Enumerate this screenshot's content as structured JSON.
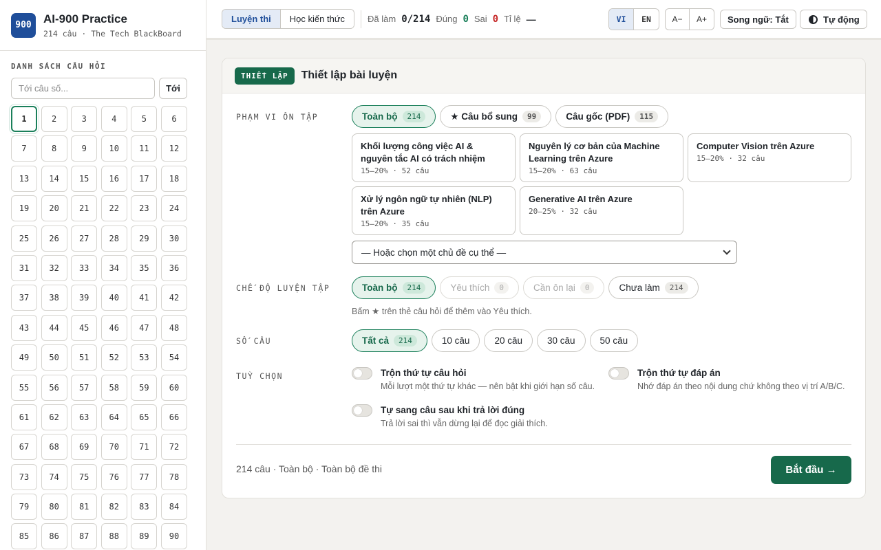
{
  "brand": {
    "logo": "900",
    "title": "AI-900 Practice",
    "subtitle": "214 câu · The Tech BlackBoard"
  },
  "sidebar": {
    "section_label": "DANH SÁCH CÂU HỎI",
    "goto_placeholder": "Tới câu số...",
    "goto_button": "Tới",
    "active_question": 1,
    "visible_questions": [
      "1",
      "2",
      "3",
      "4",
      "5",
      "6",
      "7",
      "8",
      "9",
      "10",
      "11",
      "12",
      "13",
      "14",
      "15",
      "16",
      "17",
      "18",
      "19",
      "20",
      "21",
      "22",
      "23",
      "24",
      "25",
      "26",
      "27",
      "28",
      "29",
      "30",
      "31",
      "32",
      "33",
      "34",
      "35",
      "36",
      "37",
      "38",
      "39",
      "40",
      "41",
      "42",
      "43",
      "44",
      "45",
      "46",
      "47",
      "48",
      "49",
      "50",
      "51",
      "52",
      "53",
      "54",
      "55",
      "56",
      "57",
      "58",
      "59",
      "60",
      "61",
      "62",
      "63",
      "64",
      "65",
      "66",
      "67",
      "68",
      "69",
      "70",
      "71",
      "72",
      "73",
      "74",
      "75",
      "76",
      "77",
      "78",
      "79",
      "80",
      "81",
      "82",
      "83",
      "84",
      "85",
      "86",
      "87",
      "88",
      "89",
      "90"
    ]
  },
  "topbar": {
    "tabs": [
      "Luyện thi",
      "Học kiến thức"
    ],
    "active_tab": "Luyện thi",
    "done_label": "Đã làm",
    "done_value": "0/214",
    "correct_label": "Đúng",
    "correct_value": "0",
    "wrong_label": "Sai",
    "wrong_value": "0",
    "ratio_label": "Tỉ lệ",
    "ratio_value": "—",
    "languages": [
      "VI",
      "EN"
    ],
    "active_language": "VI",
    "font_smaller": "A−",
    "font_larger": "A+",
    "bilingual_button": "Song ngữ: Tắt",
    "theme_button": "Tự động"
  },
  "card": {
    "tag": "THIẾT LẬP",
    "title": "Thiết lập bài luyện",
    "scope": {
      "label": "PHẠM VI ÔN TẬP",
      "chips": [
        {
          "label": "Toàn bộ",
          "count": "214",
          "active": true
        },
        {
          "label": "★ Câu bổ sung",
          "count": "99",
          "active": false
        },
        {
          "label": "Câu gốc (PDF)",
          "count": "115",
          "active": false
        }
      ],
      "domains": [
        {
          "title": "Khối lượng công việc AI & nguyên tắc AI có trách nhiệm",
          "meta": "15–20% · 52 câu"
        },
        {
          "title": "Nguyên lý cơ bản của Machine Learning trên Azure",
          "meta": "15–20% · 63 câu"
        },
        {
          "title": "Computer Vision trên Azure",
          "meta": "15–20% · 32 câu"
        },
        {
          "title": "Xử lý ngôn ngữ tự nhiên (NLP) trên Azure",
          "meta": "15–20% · 35 câu"
        },
        {
          "title": "Generative AI trên Azure",
          "meta": "20–25% · 32 câu"
        }
      ],
      "topic_select": "— Hoặc chọn một chủ đề cụ thể —"
    },
    "mode": {
      "label": "CHẾ ĐỘ LUYỆN TẬP",
      "chips": [
        {
          "label": "Toàn bộ",
          "count": "214"
        },
        {
          "label": "Yêu thích",
          "count": "0"
        },
        {
          "label": "Cần ôn lại",
          "count": "0"
        },
        {
          "label": "Chưa làm",
          "count": "214"
        }
      ],
      "hint": "Bấm ★ trên thẻ câu hỏi để thêm vào Yêu thích."
    },
    "count": {
      "label": "SỐ CÂU",
      "chips": [
        {
          "label": "Tất cả",
          "count": "214"
        },
        {
          "label": "10 câu"
        },
        {
          "label": "20 câu"
        },
        {
          "label": "30 câu"
        },
        {
          "label": "50 câu"
        }
      ]
    },
    "options": {
      "label": "TUỲ CHỌN",
      "shuffle_questions": {
        "title": "Trộn thứ tự câu hỏi",
        "desc": "Mỗi lượt một thứ tự khác — nên bật khi giới hạn số câu.",
        "on": false
      },
      "shuffle_answers": {
        "title": "Trộn thứ tự đáp án",
        "desc": "Nhớ đáp án theo nội dung chứ không theo vị trí A/B/C.",
        "on": false
      },
      "auto_next": {
        "title": "Tự sang câu sau khi trả lời đúng",
        "desc": "Trả lời sai thì vẫn dừng lại để đọc giải thích.",
        "on": false
      }
    },
    "summary": "214 câu · Toàn bộ · Toàn bộ đề thi",
    "start_button": "Bắt đầu →"
  },
  "colors": {
    "accent": "#17694b",
    "brand": "#1f4e9a",
    "wrong": "#c62828",
    "page_bg": "#f3f2ef"
  }
}
